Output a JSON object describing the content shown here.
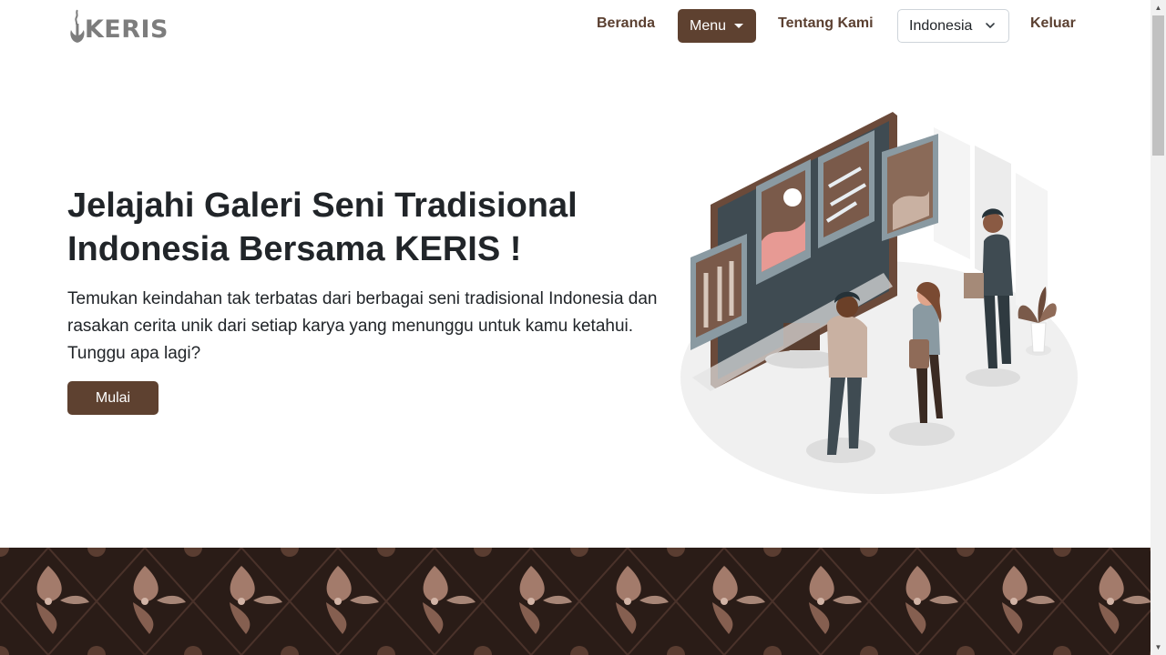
{
  "brand": {
    "name": "KERIS"
  },
  "nav": {
    "home_label": "Beranda",
    "menu_label": "Menu",
    "about_label": "Tentang Kami",
    "language_selected": "Indonesia",
    "logout_label": "Keluar"
  },
  "hero": {
    "title": "Jelajahi Galeri Seni Tradisional Indonesia Bersama KERIS !",
    "description": "Temukan keindahan tak terbatas dari berbagai seni tradisional Indonesia dan rasakan cerita unik dari setiap karya yang menunggu untuk kamu ketahui. Tunggu apa lagi?",
    "cta_label": "Mulai"
  },
  "icons": {
    "menu_caret": "caret-down-icon",
    "language_chevron": "chevron-down-icon",
    "logo": "keris-logo-icon"
  },
  "colors": {
    "primary": "#5e4130",
    "nav_text": "#5b4031",
    "logo_gray": "#7d7d7d",
    "batik_bg": "#2a1c17"
  }
}
